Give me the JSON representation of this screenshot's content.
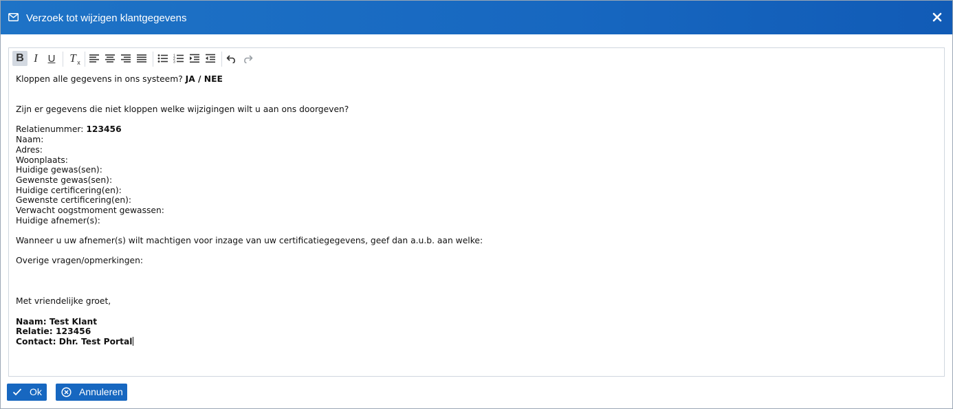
{
  "dialog": {
    "title": "Verzoek tot wijzigen klantgegevens",
    "icon": "envelope-icon",
    "close_icon": "close-icon"
  },
  "toolbar": {
    "buttons": [
      "bold",
      "italic",
      "underline",
      "clear-formatting",
      "align-left",
      "align-center",
      "align-right",
      "align-justify",
      "bulleted-list",
      "numbered-list",
      "indent",
      "outdent",
      "undo",
      "redo"
    ],
    "bold_glyph": "B",
    "italic_glyph": "I",
    "underline_glyph": "U",
    "clear_glyph": "T"
  },
  "body": {
    "q1": "Kloppen alle gegevens in ons systeem? ",
    "q1_answer": "JA / NEE",
    "q2": "Zijn er gegevens die niet kloppen welke wijzigingen wilt u aan ons doorgeven?",
    "relatie_label": "Relatienummer: ",
    "relatie_value": "123456",
    "fields": [
      "Naam:",
      "Adres:",
      "Woonplaats:",
      "Huidige gewas(sen):",
      "Gewenste gewas(sen):",
      "Huidige certificering(en):",
      "Gewenste certificering(en):",
      "Verwacht oogstmoment gewassen:",
      "Huidige afnemer(s):"
    ],
    "machtigen": "Wanneer u uw afnemer(s) wilt machtigen voor inzage van uw certificatiegegevens, geef dan a.u.b. aan welke:",
    "overige": "Overige vragen/opmerkingen:",
    "groet": "Met vriendelijke groet,",
    "sig_naam": "Naam: Test Klant",
    "sig_relatie": "Relatie: 123456",
    "sig_contact": "Contact: Dhr. Test Portal"
  },
  "buttons": {
    "ok_label": "Ok",
    "cancel_label": "Annuleren"
  },
  "colors": {
    "titlebar": "#1767c0",
    "button": "#1767c0"
  }
}
